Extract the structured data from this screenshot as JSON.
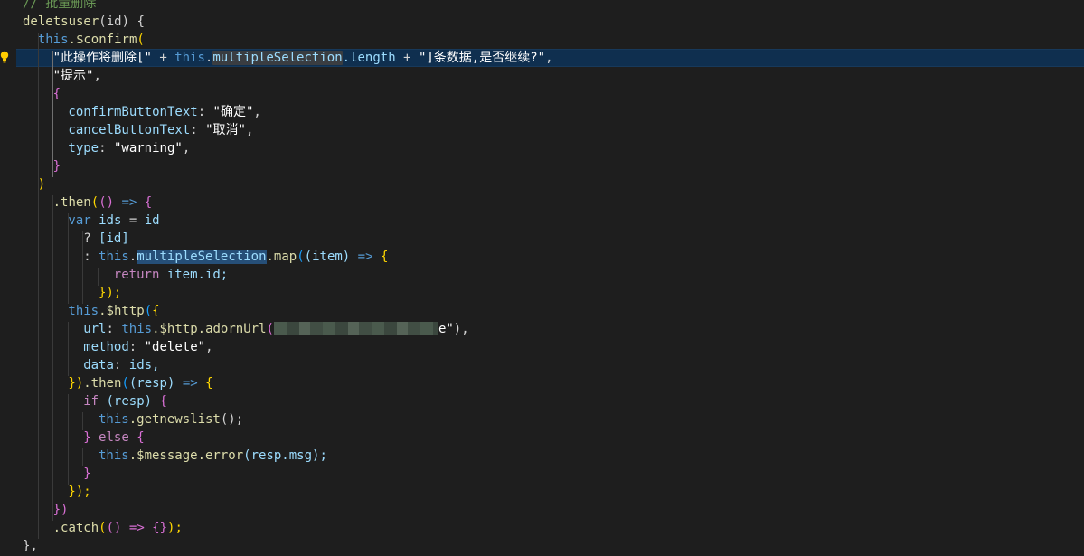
{
  "editor": {
    "language": "javascript",
    "theme_background": "#1e1e1e",
    "active_line_color": "#0f2f4f",
    "lightbulb_icon": "lightbulb-icon",
    "colors": {
      "comment": "#6a9955",
      "function": "#dcdcaa",
      "keyword": "#569cd6",
      "control": "#c586c0",
      "variable": "#9cdcfe",
      "string": "#ce9178",
      "bracket_gold": "#ffd700",
      "bracket_purple": "#da70d6",
      "bracket_blue": "#179fff"
    },
    "code": {
      "l1_comment": "// 批量删除",
      "l2_fn": "deletsuser",
      "l2_param": "(id) {",
      "l3_this": "this",
      "l3_confirm": ".$confirm",
      "l3_paren": "(",
      "l4_str1": "\"此操作将删除[\"",
      "l4_plus1": " + ",
      "l4_this": "this",
      "l4_dot": ".",
      "l4_ms": "multipleSelection",
      "l4_len": ".length",
      "l4_plus2": " + ",
      "l4_str2": "\"]条数据,是否继续?\"",
      "l4_comma": ",",
      "l5_str": "\"提示\"",
      "l5_comma": ",",
      "l6_brace": "{",
      "l7_key": "confirmButtonText",
      "l7_colon": ": ",
      "l7_val": "\"确定\"",
      "l7_comma": ",",
      "l8_key": "cancelButtonText",
      "l8_colon": ": ",
      "l8_val": "\"取消\"",
      "l8_comma": ",",
      "l9_key": "type",
      "l9_colon": ": ",
      "l9_val": "\"warning\"",
      "l9_comma": ",",
      "l10_brace": "}",
      "l11_paren": ")",
      "l12_then": ".then",
      "l12_p1": "(",
      "l12_p2": "()",
      "l12_arrow": " => ",
      "l12_brace": "{",
      "l13_var": "var",
      "l13_ids": " ids",
      "l13_eq": " = ",
      "l13_id": "id",
      "l14_q": "? ",
      "l14_arr": "[id]",
      "l15_colon": ": ",
      "l15_this": "this",
      "l15_dot": ".",
      "l15_ms": "multipleSelection",
      "l15_map": ".map",
      "l15_p1": "(",
      "l15_p2": "(item)",
      "l15_arrow": " => ",
      "l15_brace": "{",
      "l16_ret": "return",
      "l16_item": " item.id;",
      "l17_close": "});",
      "l18_this": "this",
      "l18_http": ".$http",
      "l18_p": "(",
      "l18_brace": "{",
      "l19_key": "url",
      "l19_colon": ": ",
      "l19_this": "this",
      "l19_http": ".$http",
      "l19_adorn": ".adornUrl",
      "l19_p": "(",
      "l19_tail": "e\"",
      "l19_end": "),",
      "l20_key": "method",
      "l20_colon": ": ",
      "l20_val": "\"delete\"",
      "l20_comma": ",",
      "l21_key": "data",
      "l21_colon": ": ",
      "l21_val": "ids,",
      "l22_close1": "})",
      "l22_then": ".then",
      "l22_p": "(",
      "l22_resp": "(resp)",
      "l22_arrow": " => ",
      "l22_brace": "{",
      "l23_if": "if",
      "l23_cond": " (resp) ",
      "l23_brace": "{",
      "l24_this": "this",
      "l24_call": ".getnewslist",
      "l24_end": "();",
      "l25_close": "}",
      "l25_else": " else ",
      "l25_brace": "{",
      "l26_this": "this",
      "l26_msg": ".$message",
      "l26_err": ".error",
      "l26_args": "(resp.msg);",
      "l27_close": "}",
      "l28_close": "});",
      "l29_close": "})",
      "l30_catch": ".catch",
      "l30_p": "(",
      "l30_args": "() => {}",
      "l30_end": ");",
      "l31_close": "},"
    }
  }
}
